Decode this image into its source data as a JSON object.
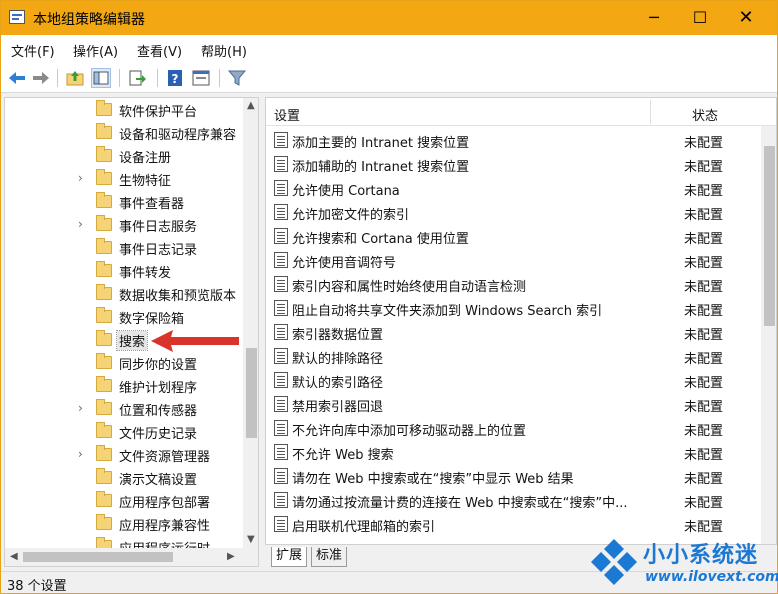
{
  "window": {
    "title": "本地组策略编辑器",
    "controls": {
      "minimize": "─",
      "maximize": "☐",
      "close": "✕"
    }
  },
  "menu": [
    "文件(F)",
    "操作(A)",
    "查看(V)",
    "帮助(H)"
  ],
  "toolbar": [
    "back-icon",
    "forward-icon",
    "up-folder-icon",
    "show-hide-tree-icon",
    "export-list-icon",
    "help-icon",
    "properties-icon",
    "filter-icon"
  ],
  "tree": {
    "items": [
      {
        "label": "软件保护平台",
        "expandable": false
      },
      {
        "label": "设备和驱动程序兼容",
        "expandable": false
      },
      {
        "label": "设备注册",
        "expandable": false
      },
      {
        "label": "生物特征",
        "expandable": true
      },
      {
        "label": "事件查看器",
        "expandable": false
      },
      {
        "label": "事件日志服务",
        "expandable": true
      },
      {
        "label": "事件日志记录",
        "expandable": false
      },
      {
        "label": "事件转发",
        "expandable": false
      },
      {
        "label": "数据收集和预览版本",
        "expandable": false
      },
      {
        "label": "数字保险箱",
        "expandable": false
      },
      {
        "label": "搜索",
        "expandable": false,
        "selected": true
      },
      {
        "label": "同步你的设置",
        "expandable": false
      },
      {
        "label": "维护计划程序",
        "expandable": false
      },
      {
        "label": "位置和传感器",
        "expandable": true
      },
      {
        "label": "文件历史记录",
        "expandable": false
      },
      {
        "label": "文件资源管理器",
        "expandable": true
      },
      {
        "label": "演示文稿设置",
        "expandable": false
      },
      {
        "label": "应用程序包部署",
        "expandable": false
      },
      {
        "label": "应用程序兼容性",
        "expandable": false
      },
      {
        "label": "应用程序运行时",
        "expandable": false
      }
    ]
  },
  "list": {
    "columns": {
      "setting": "设置",
      "state": "状态"
    },
    "rows": [
      {
        "name": "添加主要的 Intranet 搜索位置",
        "state": "未配置"
      },
      {
        "name": "添加辅助的 Intranet 搜索位置",
        "state": "未配置"
      },
      {
        "name": "允许使用 Cortana",
        "state": "未配置"
      },
      {
        "name": "允许加密文件的索引",
        "state": "未配置"
      },
      {
        "name": "允许搜索和 Cortana 使用位置",
        "state": "未配置"
      },
      {
        "name": "允许使用音调符号",
        "state": "未配置"
      },
      {
        "name": "索引内容和属性时始终使用自动语言检测",
        "state": "未配置"
      },
      {
        "name": "阻止自动将共享文件夹添加到 Windows Search 索引",
        "state": "未配置"
      },
      {
        "name": "索引器数据位置",
        "state": "未配置"
      },
      {
        "name": "默认的排除路径",
        "state": "未配置"
      },
      {
        "name": "默认的索引路径",
        "state": "未配置"
      },
      {
        "name": "禁用索引器回退",
        "state": "未配置"
      },
      {
        "name": "不允许向库中添加可移动驱动器上的位置",
        "state": "未配置"
      },
      {
        "name": "不允许 Web 搜索",
        "state": "未配置"
      },
      {
        "name": "请勿在 Web 中搜索或在“搜索”中显示 Web 结果",
        "state": "未配置"
      },
      {
        "name": "请勿通过按流量计费的连接在 Web 中搜索或在“搜索”中...",
        "state": "未配置"
      },
      {
        "name": "启用联机代理邮箱的索引",
        "state": "未配置"
      }
    ]
  },
  "tabs": [
    "扩展",
    "标准"
  ],
  "status": "38 个设置",
  "watermark": {
    "line1": "小小系统迷",
    "line2": "www.ilovext.com"
  },
  "colors": {
    "titlebar": "#f3a712",
    "accent_arrow": "#d9342b",
    "watermark": "#1b78d3"
  }
}
